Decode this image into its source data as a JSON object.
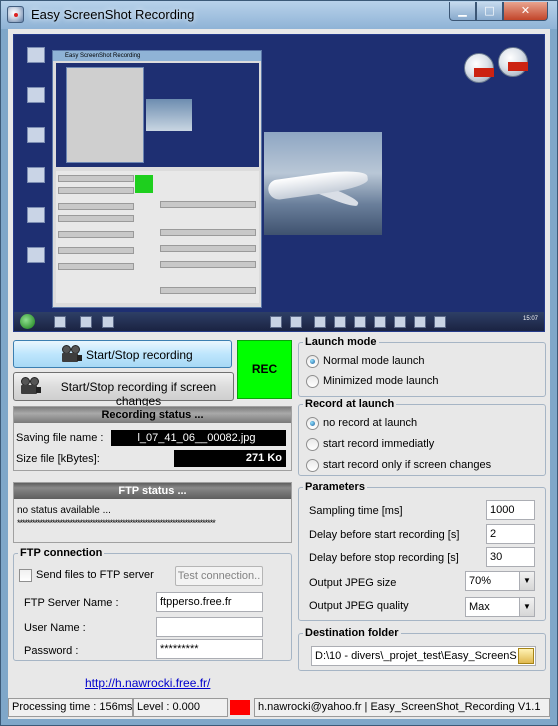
{
  "window": {
    "title": "Easy ScreenShot Recording",
    "controls": {
      "minimize": "▁",
      "maximize": "□",
      "close": "✕"
    }
  },
  "preview": {
    "mini_window_title": "Easy ScreenShot Recording",
    "taskbar_time": "15:07"
  },
  "buttons": {
    "start_stop": "Start/Stop recording",
    "start_stop_changes": "Start/Stop recording if screen changes",
    "rec_label": "REC",
    "test_connection": "Test connection.."
  },
  "recording_status": {
    "header": "Recording status ...",
    "saving_file_label": "Saving file name :",
    "saving_file_value": "l_07_41_06__00082.jpg",
    "size_label": "Size file [kBytes]:",
    "size_value": "271 Ko"
  },
  "ftp_status": {
    "header": "FTP status ...",
    "text": "no status available ...",
    "stars": "*******************************************************************************"
  },
  "ftp_connection": {
    "title": "FTP connection",
    "send_checkbox_label": "Send files to FTP server",
    "send_checked": false,
    "server_label": "FTP Server Name :",
    "server_value": "ftpperso.free.fr",
    "user_label": "User Name :",
    "user_value": "",
    "password_label": "Password :",
    "password_value": "*********"
  },
  "link_text": "http://h.nawrocki.free.fr/",
  "launch_mode": {
    "title": "Launch mode",
    "options": [
      "Normal mode launch",
      "Minimized mode launch"
    ],
    "selected_index": 0
  },
  "record_at_launch": {
    "title": "Record at launch",
    "options": [
      "no record at launch",
      "start record immediatly",
      "start record only if screen changes"
    ],
    "selected_index": 0
  },
  "parameters": {
    "title": "Parameters",
    "sampling_label": "Sampling time [ms]",
    "sampling_value": "1000",
    "delay_start_label": "Delay before start recording [s]",
    "delay_start_value": "2",
    "delay_stop_label": "Delay before stop recording [s]",
    "delay_stop_value": "30",
    "jpeg_size_label": "Output JPEG size",
    "jpeg_size_value": "70%",
    "jpeg_quality_label": "Output JPEG quality",
    "jpeg_quality_value": "Max"
  },
  "destination": {
    "title": "Destination folder",
    "path": "D:\\10 - divers\\_projet_test\\Easy_ScreenS"
  },
  "statusbar": {
    "processing": "Processing time : 156ms",
    "level": "Level : 0.000",
    "indicator_color": "#ff0000",
    "email_version": "h.nawrocki@yahoo.fr  |  Easy_ScreenShot_Recording V1.1"
  }
}
